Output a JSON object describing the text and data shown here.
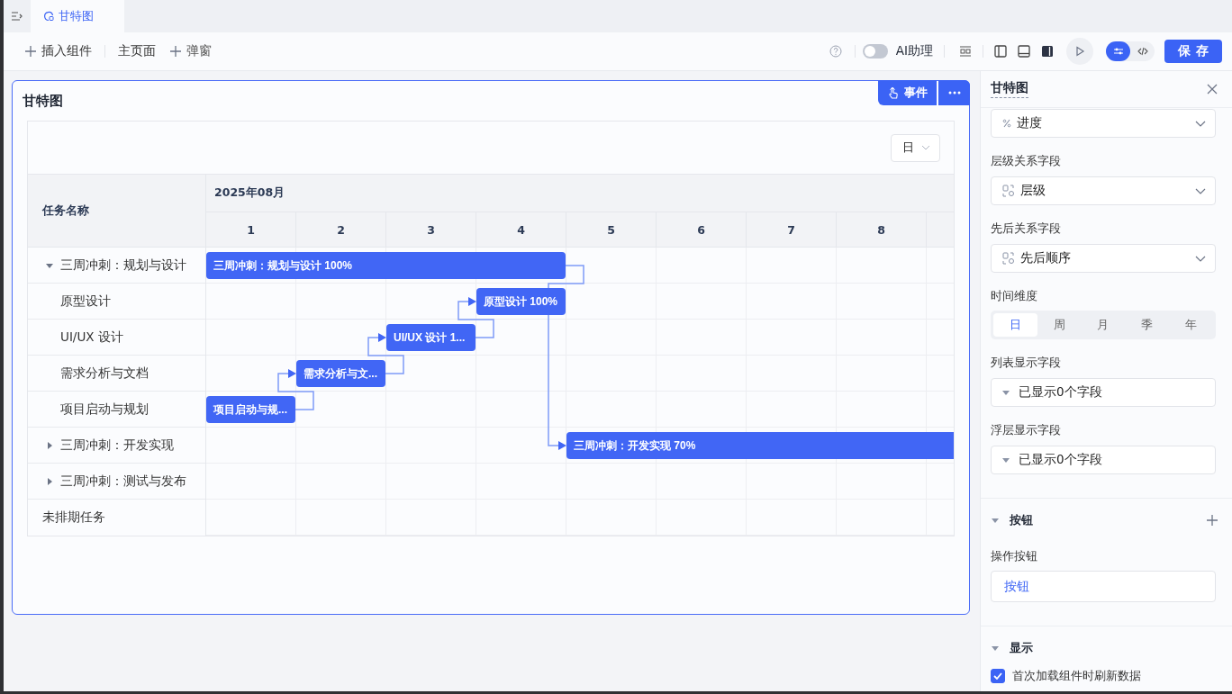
{
  "tabs": [
    {
      "label": "甘特图",
      "selected": true
    }
  ],
  "toolbar": {
    "insert_button": "插入组件",
    "page_link": "主页面",
    "popup_button": "弹窗",
    "ai_assistant": {
      "label": "AI助理",
      "on": false
    },
    "view_mode": [
      {
        "kind": "settings",
        "selected": true
      },
      {
        "kind": "code",
        "selected": false
      }
    ],
    "save_button": "保存"
  },
  "gantt": {
    "title": "甘特图",
    "event_button": "事件",
    "scale_select": "日",
    "name_header": "任务名称",
    "month": "2025年08月",
    "days": [
      "1",
      "2",
      "3",
      "4",
      "5",
      "6",
      "7",
      "8"
    ],
    "rows": [
      {
        "name": "三周冲刺：规划与设计",
        "expanded": true,
        "bar": {
          "label": "三周冲刺：规划与设计 100%"
        },
        "children": [
          {
            "name": "原型设计",
            "bar": {
              "label": "原型设计 100%"
            }
          },
          {
            "name": "UI/UX 设计",
            "bar": {
              "label": "UI/UX 设计 1..."
            }
          },
          {
            "name": "需求分析与文档",
            "bar": {
              "label": "需求分析与文..."
            }
          },
          {
            "name": "项目启动与规划",
            "bar": {
              "label": "项目启动与规..."
            }
          }
        ]
      },
      {
        "name": "三周冲刺：开发实现",
        "expanded": false,
        "bar": {
          "label": "三周冲刺：开发实现 70%"
        }
      },
      {
        "name": "三周冲刺：测试与发布",
        "expanded": false
      },
      {
        "name": "未排期任务"
      }
    ]
  },
  "panel": {
    "title": "甘特图",
    "items": [
      {
        "kind": "select",
        "value": "进度"
      },
      {
        "kind": "label",
        "text": "层级关系字段"
      },
      {
        "kind": "select",
        "value": "层级"
      },
      {
        "kind": "label",
        "text": "先后关系字段"
      },
      {
        "kind": "select",
        "value": "先后顺序"
      },
      {
        "kind": "label",
        "text": "时间维度"
      },
      {
        "kind": "segmented",
        "options": [
          {
            "label": "日",
            "selected": true
          },
          {
            "label": "周",
            "selected": false
          },
          {
            "label": "月",
            "selected": false
          },
          {
            "label": "季",
            "selected": false
          },
          {
            "label": "年",
            "selected": false
          }
        ]
      },
      {
        "kind": "label",
        "text": "列表显示字段"
      },
      {
        "kind": "fields",
        "value": "已显示0个字段"
      },
      {
        "kind": "label",
        "text": "浮层显示字段"
      },
      {
        "kind": "fields",
        "value": "已显示0个字段"
      },
      {
        "kind": "section",
        "title": "按钮",
        "add": true
      },
      {
        "kind": "label",
        "text": "操作按钮"
      },
      {
        "kind": "button_field",
        "value": "按钮"
      },
      {
        "kind": "section",
        "title": "显示",
        "add": false
      },
      {
        "kind": "checkbox",
        "label": "首次加载组件时刷新数据",
        "checked": true
      }
    ]
  }
}
